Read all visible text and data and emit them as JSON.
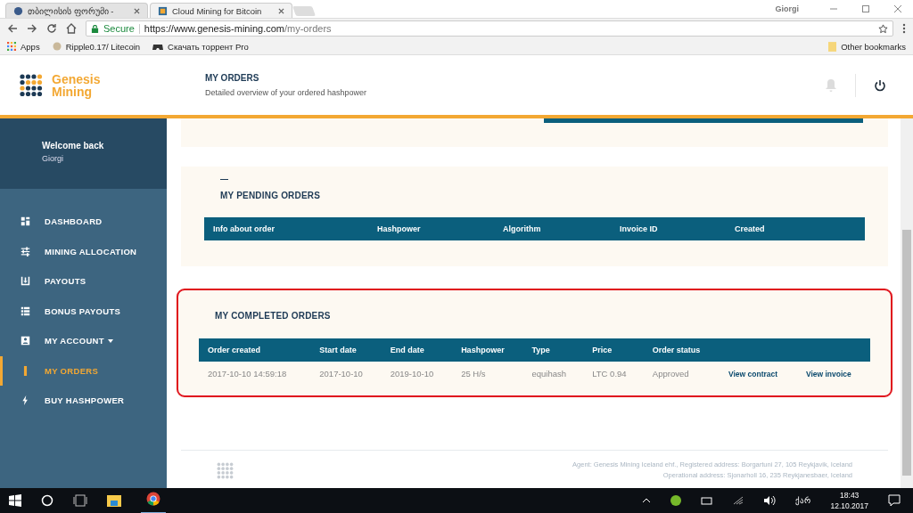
{
  "browser": {
    "tabs": [
      {
        "title": "თბილისის ფორუმი -",
        "selected": false
      },
      {
        "title": "Cloud Mining for Bitcoin",
        "selected": true
      }
    ],
    "user": "Giorgi",
    "secure_label": "Secure",
    "url_host": "https://www.genesis-mining.com",
    "url_path": "/my-orders",
    "bookmarks": [
      {
        "label": "Apps",
        "kind": "apps"
      },
      {
        "label": "Ripple0.17/ Litecoin",
        "kind": "coin"
      },
      {
        "label": "Скачать торрент Pro",
        "kind": "game"
      }
    ],
    "other_bookmarks": "Other bookmarks"
  },
  "logo": {
    "line1": "Genesis",
    "line2": "Mining"
  },
  "header": {
    "title": "MY ORDERS",
    "subtitle": "Detailed overview of your ordered hashpower"
  },
  "sidebar": {
    "welcome": "Welcome back",
    "user": "Giorgi",
    "items": [
      {
        "label": "DASHBOARD",
        "selected": false,
        "dropdown": false
      },
      {
        "label": "MINING ALLOCATION",
        "selected": false,
        "dropdown": false
      },
      {
        "label": "PAYOUTS",
        "selected": false,
        "dropdown": false
      },
      {
        "label": "BONUS PAYOUTS",
        "selected": false,
        "dropdown": false
      },
      {
        "label": "MY ACCOUNT",
        "selected": false,
        "dropdown": true
      },
      {
        "label": "MY ORDERS",
        "selected": true,
        "dropdown": false
      },
      {
        "label": "BUY HASHPOWER",
        "selected": false,
        "dropdown": false
      }
    ]
  },
  "pending": {
    "title": "MY PENDING ORDERS",
    "columns": [
      "Info about order",
      "Hashpower",
      "Algorithm",
      "Invoice ID",
      "Created"
    ]
  },
  "completed": {
    "title": "MY COMPLETED ORDERS",
    "highlighted": true,
    "columns": [
      "Order created",
      "Start date",
      "End date",
      "Hashpower",
      "Type",
      "Price",
      "Order status"
    ],
    "rows": [
      {
        "cells": [
          "2017-10-10 14:59:18",
          "2017-10-10",
          "2019-10-10",
          "25 H/s",
          "equihash",
          "LTC 0.94",
          "Approved"
        ],
        "links": [
          "View contract",
          "View invoice"
        ]
      }
    ]
  },
  "footer": {
    "lines": [
      "Agent: Genesis Mining Iceland ehf., Registered address: Borgartuni 27, 105 Reykjavik, Iceland",
      "Operational address: Sjonarholl 16, 235 Reykjanesbaer, Iceland"
    ]
  },
  "taskbar": {
    "language": "ქარ",
    "time": "18:43",
    "date": "12.10.2017"
  }
}
